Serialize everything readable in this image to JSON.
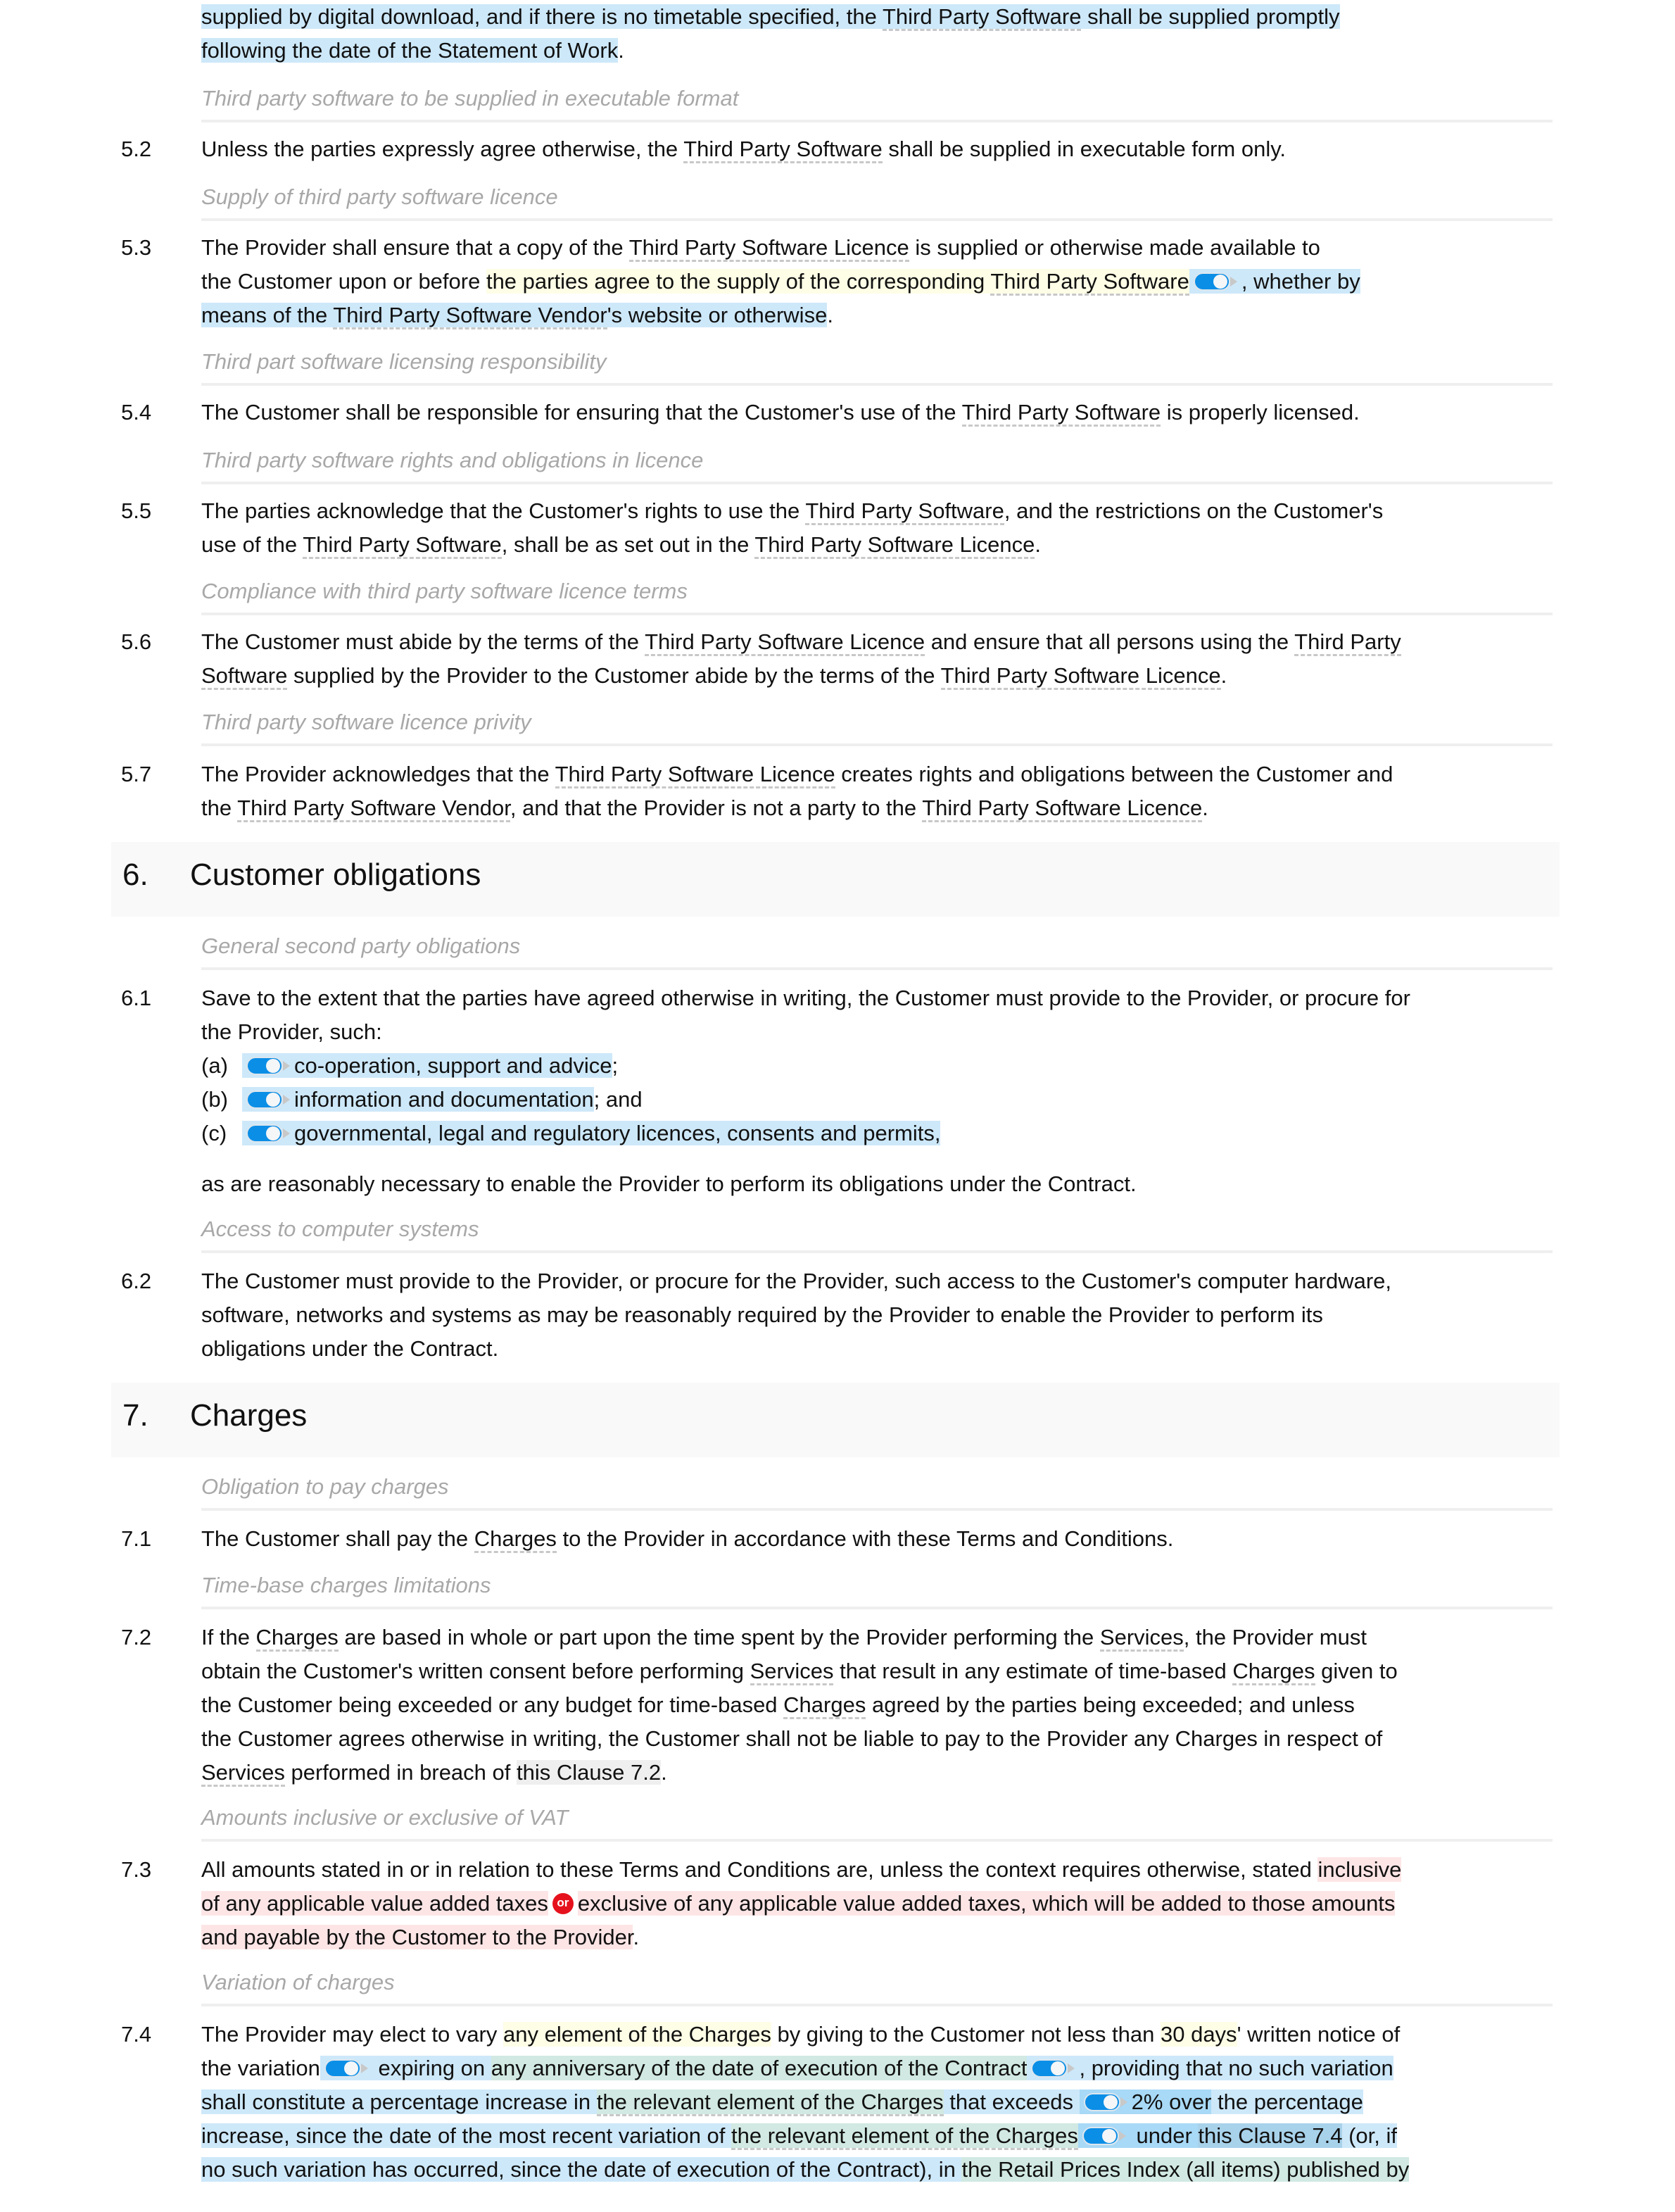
{
  "colors": {
    "option_highlight": "#cde8f9",
    "variable_highlight": "#fefde6",
    "alt_highlight": "#d1e9e2",
    "or_highlight": "#fde5e6",
    "toggle_on": "#0b8ee6",
    "or_badge": "#e5121d",
    "subheading": "#a8a8a8",
    "heading_band": "#f9f9f9"
  },
  "continuation": {
    "line1": "supplied by digital download, and if there is no timetable specified, the ",
    "term1": "Third Party Software",
    "line1b": " shall be supplied promptly",
    "line2": "following the date of the Statement of Work",
    "line2end": "."
  },
  "section5": {
    "clauses": [
      {
        "subheading": "Third party software to be supplied in executable format",
        "number": "5.2",
        "parts": [
          "Unless the parties expressly agree otherwise, the ",
          "Third Party Software",
          " shall be supplied in executable form only."
        ]
      },
      {
        "subheading": "Supply of third party software licence",
        "number": "5.3",
        "parts": [
          "The Provider shall ensure that a copy of the ",
          "Third Party Software Licence",
          " is supplied or otherwise made available to",
          "the Customer upon or before ",
          "the parties agree to the supply of the corresponding ",
          "Third Party Software",
          ", whether by",
          "means of the ",
          "Third Party Software Vendor",
          "'s website or otherwise",
          "."
        ],
        "toggle_on": true
      },
      {
        "subheading": "Third part software licensing responsibility",
        "number": "5.4",
        "parts": [
          "The Customer shall be responsible for ensuring that the Customer's use of the ",
          "Third Party Software",
          " is properly licensed."
        ]
      },
      {
        "subheading": "Third party software rights and obligations in licence",
        "number": "5.5",
        "parts": [
          "The parties acknowledge that the Customer's rights to use the ",
          "Third Party Software",
          ", and the restrictions on the Customer's",
          "use of the ",
          "Third Party Software",
          ", shall be as set out in the ",
          "Third Party Software Licence",
          "."
        ]
      },
      {
        "subheading": "Compliance with third party software licence terms",
        "number": "5.6",
        "parts": [
          "The Customer must abide by the terms of the ",
          "Third Party Software Licence",
          " and ensure that all persons using the ",
          "Third Party",
          "Software",
          " supplied by the Provider to the Customer abide by the terms of the ",
          "Third Party Software Licence",
          "."
        ]
      },
      {
        "subheading": "Third party software licence privity",
        "number": "5.7",
        "parts": [
          "The Provider acknowledges that the ",
          "Third Party Software Licence",
          " creates rights and obligations between the Customer and",
          "the ",
          "Third Party Software Vendor",
          ", and that the Provider is not a party to the ",
          "Third Party Software Licence",
          "."
        ]
      }
    ]
  },
  "section6": {
    "number": "6.",
    "title": "Customer obligations",
    "c61": {
      "subheading": "General second party obligations",
      "number": "6.1",
      "intro1": "Save to the extent that the parties have agreed otherwise in writing, the Customer must provide to the Provider, or procure for",
      "intro2": "the Provider, such:",
      "items": [
        {
          "label": "(a)",
          "text": "co-operation, support and advice",
          "tail": ";",
          "toggle_on": true
        },
        {
          "label": "(b)",
          "text": "information and documentation",
          "tail": "; and",
          "toggle_on": true
        },
        {
          "label": "(c)",
          "text": "governmental, legal and regulatory licences, consents and permits",
          "tail": ",",
          "toggle_on": true
        }
      ],
      "outro": "as are reasonably necessary to enable the Provider to perform its obligations under the Contract."
    },
    "c62": {
      "subheading": "Access to computer systems",
      "number": "6.2",
      "lines": [
        "The Customer must provide to the Provider, or procure for the Provider, such access to the Customer's computer hardware,",
        "software, networks and systems as may be reasonably required by the Provider to enable the Provider to perform its",
        "obligations under the Contract."
      ]
    }
  },
  "section7": {
    "number": "7.",
    "title": "Charges",
    "c71": {
      "subheading": "Obligation to pay charges",
      "number": "7.1",
      "parts": [
        "The Customer shall pay the ",
        "Charges",
        " to the Provider in accordance with these Terms and Conditions."
      ]
    },
    "c72": {
      "subheading": "Time-base charges limitations",
      "number": "7.2",
      "l1": [
        "If the ",
        "Charges",
        " are based in whole or part upon the time spent by the Provider performing the ",
        "Services",
        ", the Provider must"
      ],
      "l2": [
        "obtain the Customer's written consent before performing ",
        "Services",
        " that result in any estimate of time-based ",
        "Charges",
        " given to"
      ],
      "l3": [
        "the Customer being exceeded or any budget for time-based ",
        "Charges",
        " agreed by the parties being exceeded; and unless"
      ],
      "l4": "the Customer agrees otherwise in writing, the Customer shall not be liable to pay to the Provider any Charges in respect of",
      "l5": [
        "Services",
        " performed in breach of ",
        "this Clause 7.2",
        "."
      ]
    },
    "c73": {
      "subheading": "Amounts inclusive or exclusive of VAT",
      "number": "7.3",
      "l1a": "All amounts stated in or in relation to these Terms and Conditions are, unless the context requires otherwise, stated ",
      "l1b": "inclusive",
      "l2a": "of any applicable value added taxes",
      "or_label": "or",
      "l2b": "exclusive of any applicable value added taxes, which will be added to those amounts",
      "l3": "and payable by the Customer to the Provider",
      "l3end": "."
    },
    "c74": {
      "subheading": "Variation of charges",
      "number": "7.4",
      "l1": [
        "The Provider may elect to vary ",
        "any element of the Charges",
        " by giving to the Customer not less than ",
        "30 days",
        "' written notice of"
      ],
      "l2": [
        "the variation",
        " expiring on ",
        "any anniversary of the date of execution of the Contract",
        ", providing that no such variation"
      ],
      "l3": [
        "shall constitute a percentage increase in ",
        "the relevant element of the Charges",
        " that exceeds ",
        "2% over",
        " the percentage"
      ],
      "l4": [
        "increase, since the date of the most recent variation of ",
        "the relevant element of the Charges",
        " under ",
        "this Clause 7.4",
        " (or, if"
      ],
      "l5": [
        "no such variation has occurred, since the date of execution of the Contract), in ",
        "the Retail Prices Index (all items) published by"
      ]
    }
  }
}
